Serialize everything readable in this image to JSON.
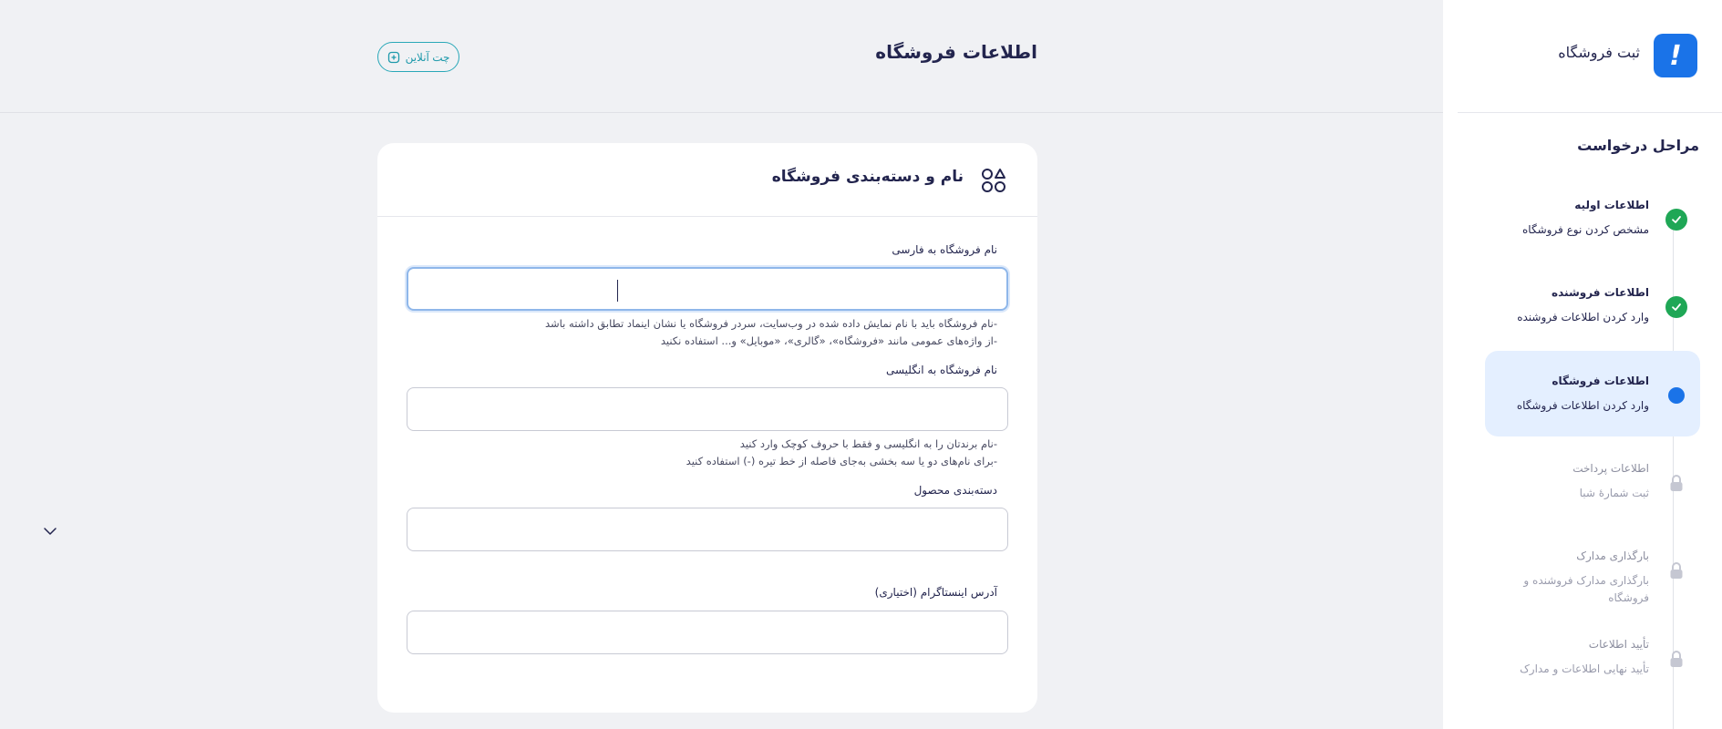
{
  "page": {
    "title": "اطلاعات فروشگاه",
    "chat_button_label": "چت آنلاین"
  },
  "sidebar": {
    "brand_title": "ثبت فروشگاه",
    "brand_icon": "exclamation-icon",
    "steps_title": "مراحل درخواست",
    "steps": [
      {
        "label": "اطلاعات اولیه",
        "sub": "مشخص کردن نوع فروشگاه",
        "status": "done"
      },
      {
        "label": "اطلاعات فروشنده",
        "sub": "وارد کردن اطلاعات فروشنده",
        "status": "done"
      },
      {
        "label": "اطلاعات فروشگاه",
        "sub": "وارد کردن اطلاعات فروشگاه",
        "status": "current"
      },
      {
        "label": "اطلاعات پرداخت",
        "sub": "ثبت شمارهٔ شبا",
        "status": "locked"
      },
      {
        "label": "بارگذاری مدارک",
        "sub": "بارگذاری مدارک فروشنده و فروشگاه",
        "status": "locked"
      },
      {
        "label": "تأیید اطلاعات",
        "sub": "تأیید نهایی اطلاعات و مدارک",
        "status": "locked"
      }
    ]
  },
  "form": {
    "section_title": "نام و دسته‌بندی فروشگاه",
    "fa_name": {
      "label": "نام فروشگاه به فارسی",
      "value": "",
      "hints": [
        "-نام فروشگاه باید با نام نمایش داده شده در وب‌سایت، سردر فروشگاه یا نشان اینماد تطابق داشته باشد",
        "-از واژه‌های عمومی مانند «فروشگاه»، «گالری»، «موبایل» و... استفاده نکنید"
      ]
    },
    "en_name": {
      "label": "نام فروشگاه به انگلیسی",
      "value": "",
      "hints": [
        "-نام برندتان را به انگلیسی و فقط با حروف کوچک وارد کنید",
        "-برای نام‌های دو یا سه بخشی به‌جای فاصله از خط تیره (-) استفاده کنید"
      ]
    },
    "category": {
      "label": "دسته‌بندی محصول",
      "value": ""
    },
    "instagram": {
      "label": "آدرس اینستاگرام (اختیاری)",
      "value": ""
    }
  },
  "colors": {
    "accent": "#1a73e8",
    "success": "#1fa756",
    "chat": "#2aa8b8",
    "active_step_bg": "#e4efff",
    "text": "#23254e"
  }
}
